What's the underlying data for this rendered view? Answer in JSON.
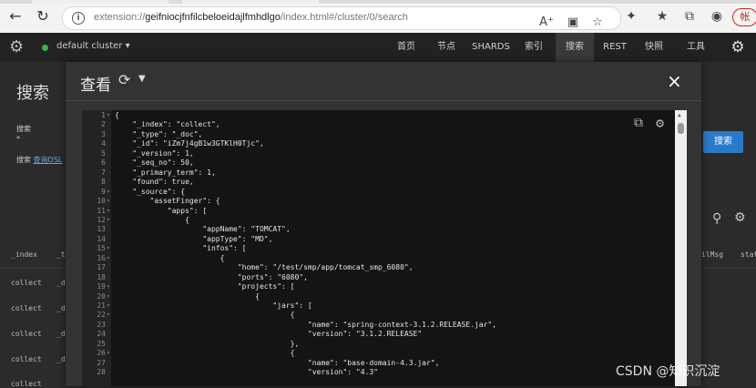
{
  "browser": {
    "url_prefix": "extension://",
    "url_host": "geifniocjfnfilcbeloeidajlfmhdlgo",
    "url_path": "/index.html#/cluster/0/search",
    "profile_label": "帐"
  },
  "appbar": {
    "cluster_name": "default cluster",
    "menu": [
      "首页",
      "节点",
      "SHARDS",
      "索引",
      "搜索",
      "REST",
      "快照",
      "工具"
    ],
    "active_menu": "搜索"
  },
  "background": {
    "title": "搜索",
    "search_label": "搜索",
    "search_value": "*",
    "dsl_prefix": "搜索",
    "dsl_link": "查询DSL",
    "search_button": "搜索",
    "col_index": "_index",
    "col_t": "_t",
    "col_errmsg": "ilMsg",
    "col_stat": "stat",
    "rows": [
      "collect",
      "collect",
      "collect",
      "collect",
      "collect"
    ],
    "row_t": "_d"
  },
  "modal": {
    "title": "查看",
    "close_label": "×"
  },
  "editor_lines": [
    {
      "n": "1",
      "fold": "▾",
      "t": "{"
    },
    {
      "n": "2",
      "fold": "",
      "t": "    \"_index\": \"collect\","
    },
    {
      "n": "3",
      "fold": "",
      "t": "    \"_type\": \"_doc\","
    },
    {
      "n": "4",
      "fold": "",
      "t": "    \"_id\": \"iZm7j4gB1w3GTKlH0Tjc\","
    },
    {
      "n": "5",
      "fold": "",
      "t": "    \"_version\": 1,"
    },
    {
      "n": "6",
      "fold": "",
      "t": "    \"_seq_no\": 50,"
    },
    {
      "n": "7",
      "fold": "",
      "t": "    \"_primary_term\": 1,"
    },
    {
      "n": "8",
      "fold": "",
      "t": "    \"found\": true,"
    },
    {
      "n": "9",
      "fold": "▾",
      "t": "    \"_source\": {"
    },
    {
      "n": "10",
      "fold": "▾",
      "t": "        \"assetFinger\": {"
    },
    {
      "n": "11",
      "fold": "▾",
      "t": "            \"apps\": ["
    },
    {
      "n": "12",
      "fold": "▾",
      "t": "                {"
    },
    {
      "n": "13",
      "fold": "",
      "t": "                    \"appName\": \"TOMCAT\","
    },
    {
      "n": "14",
      "fold": "",
      "t": "                    \"appType\": \"MD\","
    },
    {
      "n": "15",
      "fold": "▾",
      "t": "                    \"infos\": ["
    },
    {
      "n": "16",
      "fold": "▾",
      "t": "                        {"
    },
    {
      "n": "17",
      "fold": "",
      "t": "                            \"home\": \"/test/smp/app/tomcat_smp_6080\","
    },
    {
      "n": "18",
      "fold": "",
      "t": "                            \"ports\": \"6080\","
    },
    {
      "n": "19",
      "fold": "▾",
      "t": "                            \"projects\": ["
    },
    {
      "n": "20",
      "fold": "▾",
      "t": "                                {"
    },
    {
      "n": "21",
      "fold": "▾",
      "t": "                                    \"jars\": ["
    },
    {
      "n": "22",
      "fold": "▾",
      "t": "                                        {"
    },
    {
      "n": "23",
      "fold": "",
      "t": "                                            \"name\": \"spring-context-3.1.2.RELEASE.jar\","
    },
    {
      "n": "24",
      "fold": "",
      "t": "                                            \"version\": \"3.1.2.RELEASE\""
    },
    {
      "n": "25",
      "fold": "",
      "t": "                                        },"
    },
    {
      "n": "26",
      "fold": "▾",
      "t": "                                        {"
    },
    {
      "n": "27",
      "fold": "",
      "t": "                                            \"name\": \"base-domain-4.3.jar\","
    },
    {
      "n": "28",
      "fold": "",
      "t": "                                            \"version\": \"4.3\""
    }
  ],
  "watermark": "CSDN @知识沉淀",
  "colors": {
    "accent": "#2a7acb",
    "status_dot": "#3bb54a",
    "profile": "#c42b1c"
  },
  "icons": [
    "back-arrow-icon",
    "refresh-icon",
    "info-icon",
    "read-aloud-icon",
    "reader-icon",
    "star-icon",
    "extensions-icon",
    "favorites-icon",
    "collections-icon",
    "shield-icon",
    "gear-icon",
    "copy-icon",
    "close-icon",
    "search-icon"
  ]
}
